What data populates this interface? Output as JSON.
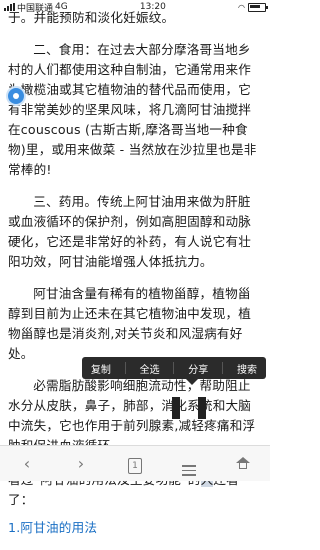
{
  "status_bar": {
    "carrier": "中国联通",
    "network": "4G",
    "time": "13:20"
  },
  "article": {
    "para0": "于。并能预防和淡化妊娠纹。",
    "para1": "二、食用：在过去大部分摩洛哥当地乡村的人们都使用这种自制油，它通常用来作为橄榄油或其它植物油的替代品而使用，它有非常美妙的坚果风味，将几滴阿甘油搅拌在couscous (古斯古斯,摩洛哥当地一种食物)里，或用来做菜 - 当然放在沙拉里也是非常棒的!",
    "para2": "三、药用。传统上阿甘油用来做为肝脏或血液循环的保护剂，例如高胆固醇和动脉硬化，它还是非常好的补药，有人说它有壮阳功效，阿甘油能增强人体抵抗力。",
    "para3": "阿甘油含量有稀有的植物甾醇，植物甾醇到目前为止还未在其它植物油中发现，植物甾醇也是消炎剂,对关节炎和风湿病有好处。",
    "para4": "必需脂肪酸影响细胞流动性，帮助阻止水分从皮肤，鼻子，肺部，消化系统和大脑中流失，它也作用于前列腺素,减轻疼痛和浮肿和促进血液循环。",
    "related_prefix": "看过“阿甘油的用法及主要功能”的",
    "related_selected": "人",
    "related_suffix": "还看了：",
    "link_index": "1.",
    "link_text": "阿甘油的用法"
  },
  "context_menu": {
    "copy": "复制",
    "select_all": "全选",
    "share": "分享",
    "search": "搜索"
  },
  "bottom_nav": {
    "tab_count": "1"
  }
}
